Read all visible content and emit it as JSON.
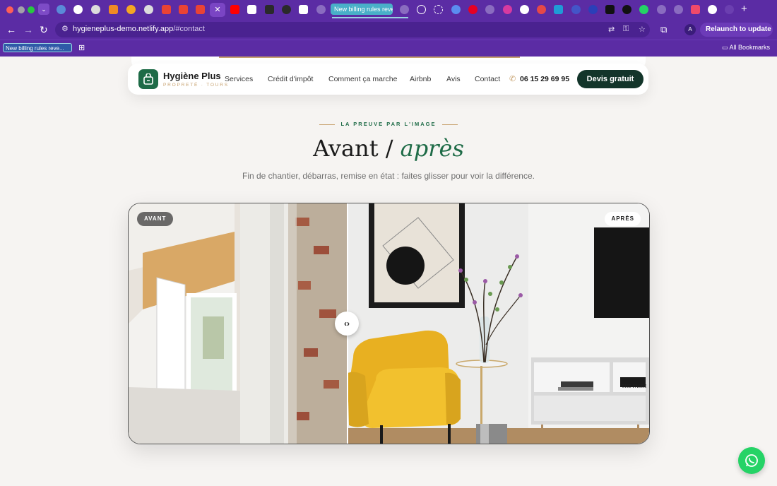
{
  "browser": {
    "active_tab_title": "New billing rules reve",
    "close_glyph": "✕",
    "new_tab_glyph": "+",
    "url_host": "hygieneplus-demo.netlify.app",
    "url_path": "/#contact",
    "relaunch_label": "Relaunch to update",
    "avatar_letter": "A",
    "bookmark_chip": "New billing rules reve...",
    "all_bookmarks": "All Bookmarks"
  },
  "header": {
    "brand": "Hygiène Plus",
    "brand_sub": "PROPRETÉ · TOURS",
    "nav": [
      "Services",
      "Crédit d'impôt",
      "Comment ça marche",
      "Airbnb",
      "Avis",
      "Contact"
    ],
    "phone": "06 15 29 69 95",
    "cta": "Devis gratuit"
  },
  "section": {
    "eyebrow": "LA PREUVE PAR L'IMAGE",
    "title_main": "Avant / ",
    "title_accent": "après",
    "subtitle": "Fin de chantier, débarras, remise en état : faites glisser pour voir la différence."
  },
  "compare": {
    "before_label": "AVANT",
    "after_label": "APRÈS",
    "handle_glyph": "‹›",
    "book_text": "THE FASHI",
    "slider_position": 0.42
  },
  "colors": {
    "browser_chrome": "#5b2ca4",
    "brand_green": "#1e6b47",
    "cta_dark": "#13352a",
    "gold": "#c7a16e",
    "chair_yellow": "#f2c12e",
    "whatsapp": "#25d366"
  }
}
